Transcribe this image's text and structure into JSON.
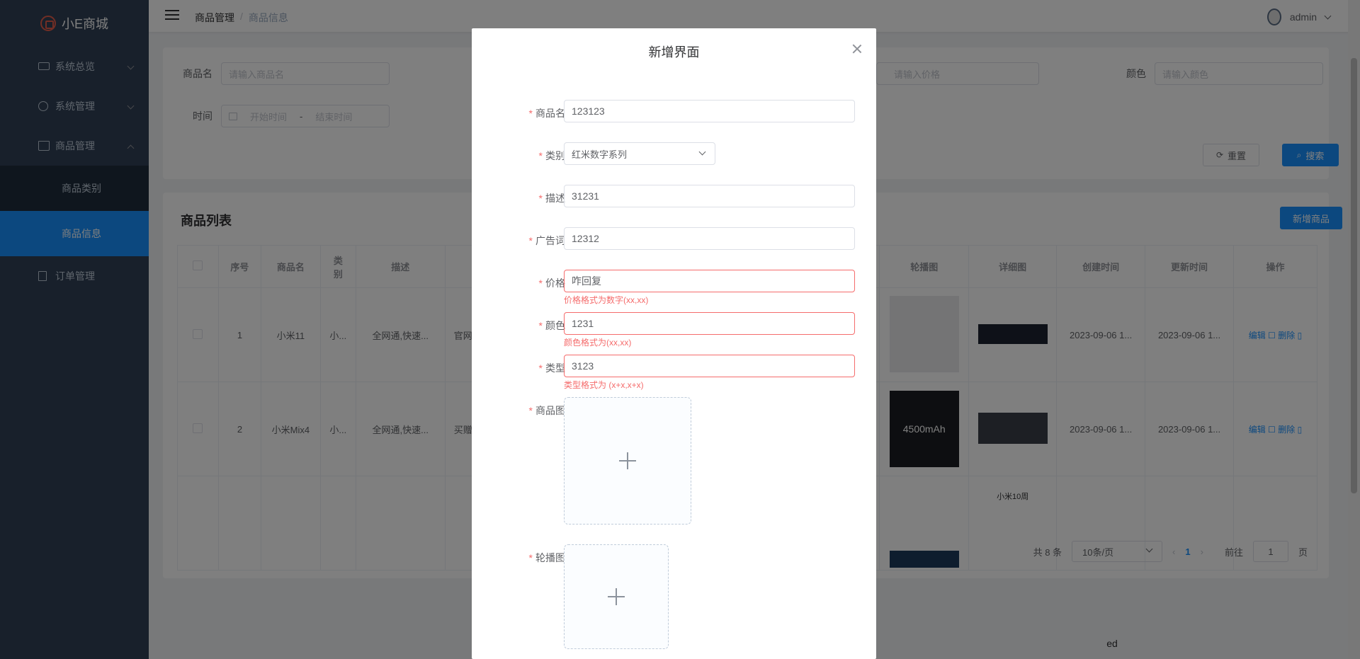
{
  "sidebar": {
    "logo_text": "小E商城",
    "items": [
      {
        "label": "系统总览",
        "icon": "monitor-icon"
      },
      {
        "label": "系统管理",
        "icon": "gear-icon"
      },
      {
        "label": "商品管理",
        "icon": "bag-icon"
      },
      {
        "label": "订单管理",
        "icon": "document-icon"
      }
    ],
    "subitems": [
      {
        "label": "商品类别"
      },
      {
        "label": "商品信息"
      }
    ]
  },
  "navbar": {
    "breadcrumb": [
      "商品管理",
      "商品信息"
    ],
    "separator": "/",
    "username": "admin"
  },
  "search": {
    "name_label": "商品名",
    "name_placeholder": "请输入商品名",
    "price_placeholder": "请输入价格",
    "color_label": "颜色",
    "color_placeholder": "请输入颜色",
    "time_label": "时间",
    "start_placeholder": "开始时间",
    "range_sep": "-",
    "end_placeholder": "结束时间",
    "reset_label": "重置",
    "search_label": "搜索"
  },
  "list": {
    "title": "商品列表",
    "add_button": "新增商品",
    "left_headers": [
      "序号",
      "商品名",
      "类别",
      "描述"
    ],
    "right_headers": [
      "轮播图",
      "详细图",
      "创建时间",
      "更新时间",
      "操作"
    ],
    "rows": [
      {
        "index": "1",
        "name": "小米11",
        "category": "小...",
        "desc": "全网通,快速...",
        "ad": "官网",
        "created": "2023-09-06 1...",
        "updated": "2023-09-06 1...",
        "edit": "编辑",
        "delete": "删除"
      },
      {
        "index": "2",
        "name": "小米Mix4",
        "category": "小...",
        "desc": "全网通,快速...",
        "ad": "买赠",
        "created": "2023-09-06 1...",
        "updated": "2023-09-06 1...",
        "edit": "编辑",
        "delete": "删除"
      }
    ],
    "thumb_texts": [
      "4500mAh",
      "小米10周"
    ]
  },
  "pagination": {
    "total": "共 8 条",
    "page_size": "10条/页",
    "current_page": "1",
    "goto_label": "前往",
    "goto_value": "1",
    "page_unit": "页"
  },
  "footer_text": "ed",
  "dialog": {
    "title": "新增界面",
    "fields": [
      {
        "label": "商品名",
        "value": "123123"
      },
      {
        "label": "类别",
        "value": "红米数字系列"
      },
      {
        "label": "描述",
        "value": "31231"
      },
      {
        "label": "广告词",
        "value": "12312"
      },
      {
        "label": "价格",
        "value": "咋回复",
        "error": "价格格式为数字(xx,xx)"
      },
      {
        "label": "颜色",
        "value": "1231",
        "error": "颜色格式为(xx,xx)"
      },
      {
        "label": "类型",
        "value": "3123",
        "error": "类型格式为 (x+x,x+x)"
      }
    ],
    "upload_product_label": "商品图",
    "upload_carousel_label": "轮播图",
    "required_mark": "*"
  },
  "colors": {
    "accent": "#1890ff",
    "sidebar_bg": "#304156",
    "error": "#f56c6c"
  }
}
